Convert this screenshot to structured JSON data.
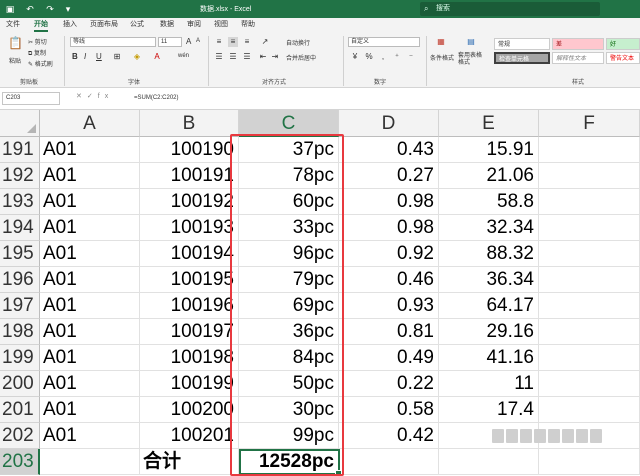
{
  "titlebar": {
    "doc_title": "数据.xlsx - Excel",
    "search_placeholder": "搜索",
    "save_icon": "save-icon",
    "undo_icon": "undo-icon",
    "redo_icon": "redo-icon"
  },
  "tabs": [
    {
      "label": "文件",
      "active": false
    },
    {
      "label": "开始",
      "active": true
    },
    {
      "label": "插入",
      "active": false
    },
    {
      "label": "页面布局",
      "active": false
    },
    {
      "label": "公式",
      "active": false
    },
    {
      "label": "数据",
      "active": false
    },
    {
      "label": "审阅",
      "active": false
    },
    {
      "label": "视图",
      "active": false
    },
    {
      "label": "帮助",
      "active": false
    }
  ],
  "ribbon": {
    "clipboard": {
      "paste": "粘贴",
      "cut": "剪切",
      "copy": "复制",
      "format_painter": "格式刷",
      "label": "剪贴板"
    },
    "font": {
      "name": "等线",
      "size": "11",
      "label": "字体",
      "bold": "B",
      "italic": "I",
      "underline": "U",
      "grow": "A",
      "shrink": "A",
      "wen": "wén"
    },
    "alignment": {
      "wrap": "自动换行",
      "merge": "合并后居中",
      "label": "对齐方式"
    },
    "number": {
      "format": "自定义",
      "label": "数字"
    },
    "styles": {
      "conditional": "条件格式",
      "table_format": "套用表格格式",
      "normal": "常规",
      "bad": "差",
      "good": "好",
      "check_cell": "检查单元格",
      "explanatory": "解释性文本",
      "warning": "警告文本",
      "label": "样式"
    }
  },
  "formula_bar": {
    "name_box": "C203",
    "formula": "=SUM(C2:C202)"
  },
  "columns": [
    "A",
    "B",
    "C",
    "D",
    "E",
    "F"
  ],
  "rows": [
    {
      "num": "191",
      "a": "A01",
      "b": "100190",
      "c": "37pc",
      "d": "0.43",
      "e": "15.91"
    },
    {
      "num": "192",
      "a": "A01",
      "b": "100191",
      "c": "78pc",
      "d": "0.27",
      "e": "21.06"
    },
    {
      "num": "193",
      "a": "A01",
      "b": "100192",
      "c": "60pc",
      "d": "0.98",
      "e": "58.8"
    },
    {
      "num": "194",
      "a": "A01",
      "b": "100193",
      "c": "33pc",
      "d": "0.98",
      "e": "32.34"
    },
    {
      "num": "195",
      "a": "A01",
      "b": "100194",
      "c": "96pc",
      "d": "0.92",
      "e": "88.32"
    },
    {
      "num": "196",
      "a": "A01",
      "b": "100195",
      "c": "79pc",
      "d": "0.46",
      "e": "36.34"
    },
    {
      "num": "197",
      "a": "A01",
      "b": "100196",
      "c": "69pc",
      "d": "0.93",
      "e": "64.17"
    },
    {
      "num": "198",
      "a": "A01",
      "b": "100197",
      "c": "36pc",
      "d": "0.81",
      "e": "29.16"
    },
    {
      "num": "199",
      "a": "A01",
      "b": "100198",
      "c": "84pc",
      "d": "0.49",
      "e": "41.16"
    },
    {
      "num": "200",
      "a": "A01",
      "b": "100199",
      "c": "50pc",
      "d": "0.22",
      "e": "11"
    },
    {
      "num": "201",
      "a": "A01",
      "b": "100200",
      "c": "30pc",
      "d": "0.58",
      "e": "17.4"
    },
    {
      "num": "202",
      "a": "A01",
      "b": "100201",
      "c": "99pc",
      "d": "0.42",
      "e": ""
    }
  ],
  "total_row": {
    "num": "203",
    "label": "合计",
    "value": "12528pc"
  },
  "colors": {
    "accent": "#217346",
    "highlight": "#e8393f"
  }
}
